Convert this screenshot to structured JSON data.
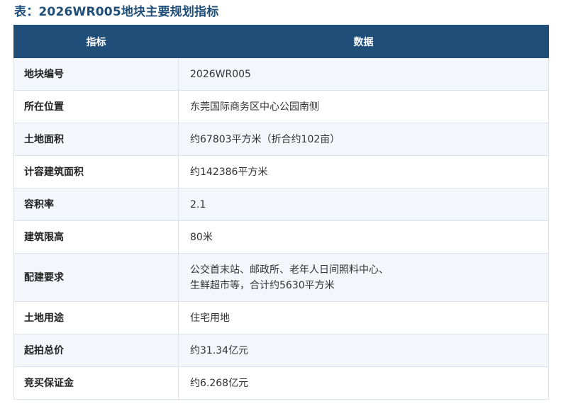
{
  "caption": "表：2026WR005地块主要规划指标",
  "table": {
    "headers": [
      "指标",
      "数据"
    ],
    "rows": [
      {
        "key": "地块编号",
        "lines": [
          "2026WR005"
        ]
      },
      {
        "key": "所在位置",
        "lines": [
          "东莞国际商务区中心公园南侧"
        ]
      },
      {
        "key": "土地面积",
        "lines": [
          "约67803平方米（折合约102亩）"
        ]
      },
      {
        "key": "计容建筑面积",
        "lines": [
          "约142386平方米"
        ]
      },
      {
        "key": "容积率",
        "lines": [
          "2.1"
        ]
      },
      {
        "key": "建筑限高",
        "lines": [
          "80米"
        ]
      },
      {
        "key": "配建要求",
        "lines": [
          "公交首末站、邮政所、老年人日间照料中心、",
          "生鲜超市等，合计约5630平方米"
        ]
      },
      {
        "key": "土地用途",
        "lines": [
          "住宅用地"
        ]
      },
      {
        "key": "起拍总价",
        "lines": [
          "约31.34亿元"
        ]
      },
      {
        "key": "竞买保证金",
        "lines": [
          "约6.268亿元"
        ]
      }
    ]
  },
  "colors": {
    "header_bg": "#1f4e79",
    "caption": "#1f4e79",
    "alt_row_bg": "#f3f6fa"
  }
}
